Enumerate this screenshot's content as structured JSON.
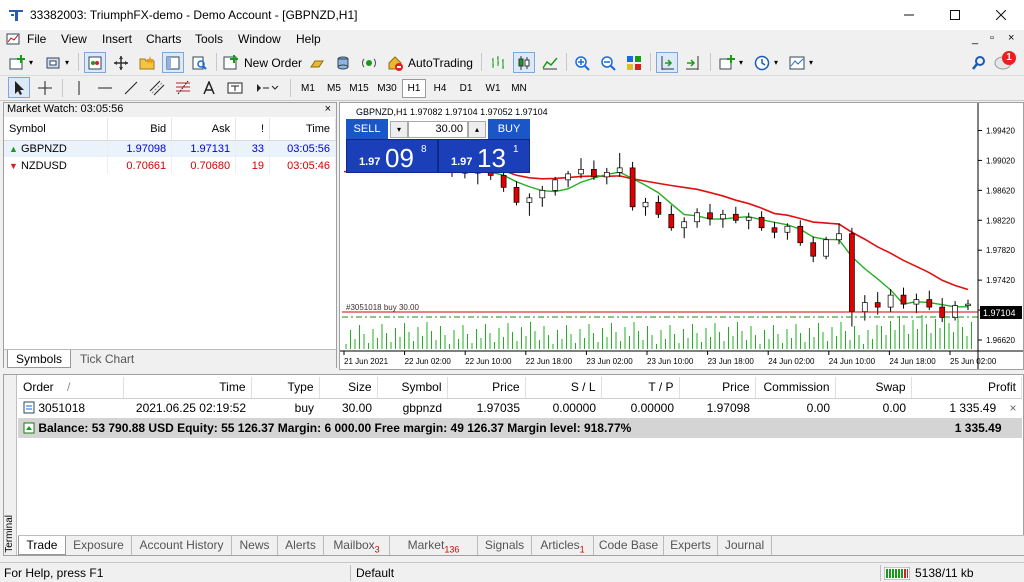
{
  "window": {
    "title": "33382003: TriumphFX-demo - Demo Account - [GBPNZD,H1]"
  },
  "menu": [
    "File",
    "View",
    "Insert",
    "Charts",
    "Tools",
    "Window",
    "Help"
  ],
  "toolbar": {
    "new_order_label": "New Order",
    "autotrading_label": "AutoTrading",
    "notification_count": "1"
  },
  "timeframes": [
    "M1",
    "M5",
    "M15",
    "M30",
    "H1",
    "H4",
    "D1",
    "W1",
    "MN"
  ],
  "active_timeframe": "H1",
  "market_watch": {
    "title": "Market Watch: 03:05:56",
    "columns": [
      "Symbol",
      "Bid",
      "Ask",
      "!",
      "Time"
    ],
    "rows": [
      {
        "symbol": "GBPNZD",
        "bid": "1.97098",
        "ask": "1.97131",
        "spread": "33",
        "time": "03:05:56",
        "direction": "up"
      },
      {
        "symbol": "NZDUSD",
        "bid": "0.70661",
        "ask": "0.70680",
        "spread": "19",
        "time": "03:05:46",
        "direction": "down"
      }
    ],
    "tabs": [
      "Symbols",
      "Tick Chart"
    ]
  },
  "chart_panel": {
    "header": "GBPNZD,H1  1.97082 1.97104 1.97052 1.97104",
    "sell_label": "SELL",
    "buy_label": "BUY",
    "volume": "30.00",
    "sell_price_small": "1.97",
    "sell_price_big": "09",
    "sell_price_sup": "8",
    "buy_price_small": "1.97",
    "buy_price_big": "13",
    "buy_price_sup": "1",
    "order_line_label": "#3051018 buy 30.00",
    "current_price_label": "1.97104",
    "price_ticks": [
      "1.99420",
      "1.99020",
      "1.98620",
      "1.98220",
      "1.97820",
      "1.97420",
      "1.97020",
      "1.96620"
    ],
    "time_ticks": [
      "21 Jun 2021",
      "22 Jun 02:00",
      "22 Jun 10:00",
      "22 Jun 18:00",
      "23 Jun 02:00",
      "23 Jun 10:00",
      "23 Jun 18:00",
      "24 Jun 02:00",
      "24 Jun 10:00",
      "24 Jun 18:00",
      "25 Jun 02:00"
    ],
    "colors": {
      "bull": "#ffffff",
      "bear": "#e00000",
      "ma_fast": "#22b022",
      "ma_slow": "#e01010",
      "volume": "#22b022",
      "order_line": "#d80000"
    }
  },
  "chart_data": {
    "type": "candlestick",
    "ylim": [
      1.965,
      1.996
    ],
    "candles": [
      {
        "o": 1.9895,
        "h": 1.9903,
        "l": 1.988,
        "c": 1.989
      },
      {
        "o": 1.989,
        "h": 1.9897,
        "l": 1.9878,
        "c": 1.9885
      },
      {
        "o": 1.9885,
        "h": 1.9892,
        "l": 1.987,
        "c": 1.9888
      },
      {
        "o": 1.9888,
        "h": 1.9895,
        "l": 1.9876,
        "c": 1.9882
      },
      {
        "o": 1.9882,
        "h": 1.989,
        "l": 1.986,
        "c": 1.9866
      },
      {
        "o": 1.9866,
        "h": 1.9874,
        "l": 1.9842,
        "c": 1.9846
      },
      {
        "o": 1.9846,
        "h": 1.9858,
        "l": 1.9828,
        "c": 1.9852
      },
      {
        "o": 1.9852,
        "h": 1.9868,
        "l": 1.984,
        "c": 1.9862
      },
      {
        "o": 1.9862,
        "h": 1.988,
        "l": 1.9855,
        "c": 1.9876
      },
      {
        "o": 1.9876,
        "h": 1.9888,
        "l": 1.9866,
        "c": 1.9884
      },
      {
        "o": 1.9884,
        "h": 1.9905,
        "l": 1.9878,
        "c": 1.989
      },
      {
        "o": 1.989,
        "h": 1.9902,
        "l": 1.9876,
        "c": 1.988
      },
      {
        "o": 1.988,
        "h": 1.9892,
        "l": 1.987,
        "c": 1.9886
      },
      {
        "o": 1.9886,
        "h": 1.9912,
        "l": 1.988,
        "c": 1.9892
      },
      {
        "o": 1.9892,
        "h": 1.99,
        "l": 1.9835,
        "c": 1.984
      },
      {
        "o": 1.984,
        "h": 1.9852,
        "l": 1.9828,
        "c": 1.9846
      },
      {
        "o": 1.9846,
        "h": 1.9855,
        "l": 1.9825,
        "c": 1.983
      },
      {
        "o": 1.983,
        "h": 1.9842,
        "l": 1.9808,
        "c": 1.9812
      },
      {
        "o": 1.9812,
        "h": 1.9826,
        "l": 1.9798,
        "c": 1.982
      },
      {
        "o": 1.982,
        "h": 1.9838,
        "l": 1.9812,
        "c": 1.9832
      },
      {
        "o": 1.9832,
        "h": 1.9844,
        "l": 1.9815,
        "c": 1.9824
      },
      {
        "o": 1.9824,
        "h": 1.9836,
        "l": 1.9812,
        "c": 1.983
      },
      {
        "o": 1.983,
        "h": 1.984,
        "l": 1.9818,
        "c": 1.9822
      },
      {
        "o": 1.9822,
        "h": 1.9832,
        "l": 1.981,
        "c": 1.9826
      },
      {
        "o": 1.9826,
        "h": 1.9834,
        "l": 1.9808,
        "c": 1.9812
      },
      {
        "o": 1.9812,
        "h": 1.982,
        "l": 1.9798,
        "c": 1.9806
      },
      {
        "o": 1.9806,
        "h": 1.9818,
        "l": 1.9796,
        "c": 1.9814
      },
      {
        "o": 1.9814,
        "h": 1.9822,
        "l": 1.9788,
        "c": 1.9792
      },
      {
        "o": 1.9792,
        "h": 1.98,
        "l": 1.9766,
        "c": 1.9774
      },
      {
        "o": 1.9774,
        "h": 1.98,
        "l": 1.977,
        "c": 1.9796
      },
      {
        "o": 1.9796,
        "h": 1.9818,
        "l": 1.979,
        "c": 1.9804
      },
      {
        "o": 1.9804,
        "h": 1.9812,
        "l": 1.968,
        "c": 1.97
      },
      {
        "o": 1.97,
        "h": 1.9722,
        "l": 1.9688,
        "c": 1.9712
      },
      {
        "o": 1.9712,
        "h": 1.9726,
        "l": 1.9696,
        "c": 1.9706
      },
      {
        "o": 1.9706,
        "h": 1.973,
        "l": 1.97,
        "c": 1.9722
      },
      {
        "o": 1.9722,
        "h": 1.9732,
        "l": 1.9704,
        "c": 1.971
      },
      {
        "o": 1.971,
        "h": 1.9724,
        "l": 1.9698,
        "c": 1.9716
      },
      {
        "o": 1.9716,
        "h": 1.9728,
        "l": 1.9702,
        "c": 1.9706
      },
      {
        "o": 1.9706,
        "h": 1.9718,
        "l": 1.9686,
        "c": 1.9692
      },
      {
        "o": 1.9692,
        "h": 1.9714,
        "l": 1.9688,
        "c": 1.9708
      },
      {
        "o": 1.9708,
        "h": 1.9716,
        "l": 1.9702,
        "c": 1.971
      }
    ]
  },
  "terminal": {
    "side_label": "Terminal",
    "columns": [
      "Order",
      "/",
      "Time",
      "Type",
      "Size",
      "Symbol",
      "Price",
      "S / L",
      "T / P",
      "Price",
      "Commission",
      "Swap",
      "Profit"
    ],
    "order": {
      "id": "3051018",
      "time": "2021.06.25 02:19:52",
      "type": "buy",
      "size": "30.00",
      "symbol": "gbpnzd",
      "price": "1.97035",
      "sl": "0.00000",
      "tp": "0.00000",
      "current_price": "1.97098",
      "commission": "0.00",
      "swap": "0.00",
      "profit": "1 335.49"
    },
    "balance_line": "Balance: 53 790.88 USD  Equity: 55 126.37  Margin: 6 000.00  Free margin: 49 126.37  Margin level: 918.77%",
    "balance_profit": "1 335.49",
    "tabs": [
      {
        "label": "Trade",
        "badge": ""
      },
      {
        "label": "Exposure",
        "badge": ""
      },
      {
        "label": "Account History",
        "badge": ""
      },
      {
        "label": "News",
        "badge": ""
      },
      {
        "label": "Alerts",
        "badge": ""
      },
      {
        "label": "Mailbox",
        "badge": "3"
      },
      {
        "label": "Market",
        "badge": "136"
      },
      {
        "label": "Signals",
        "badge": ""
      },
      {
        "label": "Articles",
        "badge": "1"
      },
      {
        "label": "Code Base",
        "badge": ""
      },
      {
        "label": "Experts",
        "badge": ""
      },
      {
        "label": "Journal",
        "badge": ""
      }
    ]
  },
  "status_bar": {
    "help": "For Help, press F1",
    "profile": "Default",
    "traffic": "5138/11 kb"
  }
}
